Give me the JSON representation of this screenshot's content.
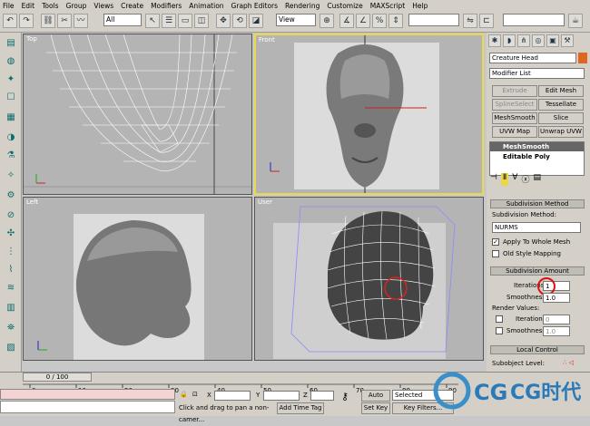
{
  "menubar": [
    "File",
    "Edit",
    "Tools",
    "Group",
    "Views",
    "Create",
    "Modifiers",
    "Animation",
    "Graph Editors",
    "Rendering",
    "Customize",
    "MAXScript",
    "Help"
  ],
  "toolbar": {
    "selection_filter": "All",
    "reference_coord": "View"
  },
  "viewports": {
    "top": "Top",
    "front": "Front",
    "left": "Left",
    "user": "User"
  },
  "command_panel": {
    "object_name": "Creature Head",
    "modifier_list": "Modifier List",
    "modifier_buttons": [
      "Extrude",
      "Edit Mesh",
      "SplineSelect",
      "Tessellate",
      "MeshSmooth",
      "Slice",
      "UVW Map",
      "Unwrap UVW"
    ],
    "stack": [
      "MeshSmooth",
      "Editable Poly"
    ],
    "subdivision_method": {
      "header": "Subdivision Method",
      "label": "Subdivision Method:",
      "value": "NURMS",
      "apply_whole": "Apply To Whole Mesh",
      "old_style": "Old Style Mapping"
    },
    "subdivision_amount": {
      "header": "Subdivision Amount",
      "iterations_label": "Iterations:",
      "iterations": "1",
      "smoothness_label": "Smoothness:",
      "smoothness": "1.0",
      "render_values": "Render Values:",
      "r_iterations_label": "Iterations:",
      "r_iterations": "0",
      "r_smoothness_label": "Smoothness:",
      "r_smoothness": "1.0"
    },
    "local_control": {
      "header": "Local Control",
      "sublevel": "Subobject Level:"
    }
  },
  "timeline": {
    "frame": "0 / 100",
    "ticks": [
      "0",
      "10",
      "20",
      "30",
      "40",
      "50",
      "60",
      "70",
      "80",
      "90"
    ]
  },
  "status": {
    "x": "X",
    "y": "Y",
    "z": "Z",
    "auto_key": "Auto Key",
    "selected": "Selected",
    "set_key": "Set Key",
    "key_filters": "Key Filters...",
    "prompt": "Click and drag to pan a non-camer...",
    "add_time_tag": "Add Time Tag"
  },
  "watermark": "CG时代"
}
